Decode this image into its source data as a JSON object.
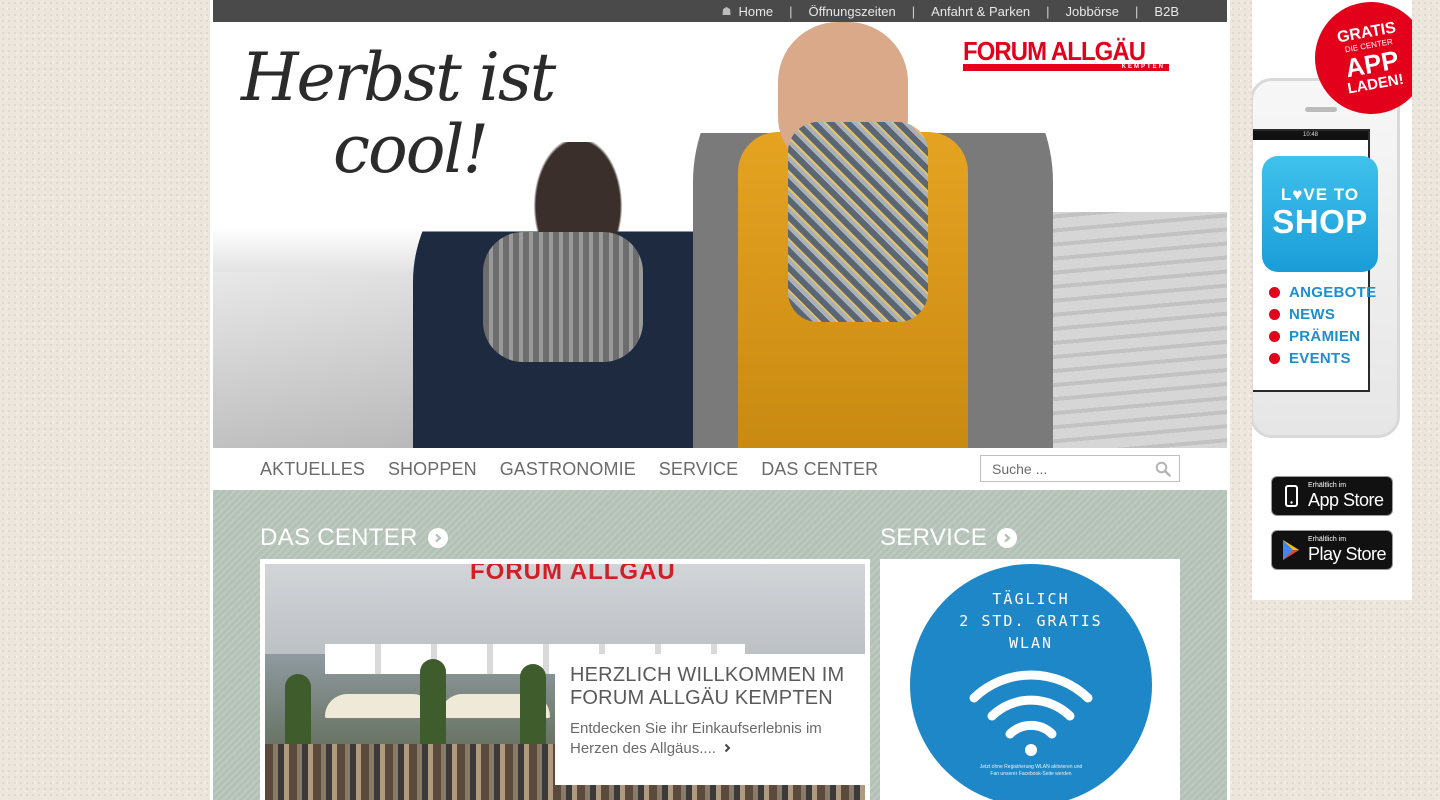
{
  "topnav": {
    "home": "Home",
    "items": [
      "Öffnungszeiten",
      "Anfahrt & Parken",
      "Jobbörse",
      "B2B"
    ],
    "separator": "|"
  },
  "hero": {
    "slogan_line1": "Herbst ist",
    "slogan_line2": "cool!",
    "logo_text": "FORUM ALLGÄU",
    "logo_sub": "KEMPTEN"
  },
  "mainnav": {
    "items": [
      "AKTUELLES",
      "SHOPPEN",
      "GASTRONOMIE",
      "SERVICE",
      "DAS CENTER"
    ],
    "search_placeholder": "Suche ..."
  },
  "center_section": {
    "title": "DAS CENTER",
    "photo_sign": "FORUM ALLGÄU",
    "card_title": "HERZLICH WILLKOMMEN IM FORUM ALLGÄU KEMPTEN",
    "card_text": "Entdecken Sie ihr Einkaufserlebnis im Herzen des Allgäus....",
    "more_icon": "chevron-right-icon"
  },
  "service_section": {
    "title": "SERVICE",
    "wlan_headline": "TÄGLICH\n2 STD. GRATIS\nWLAN",
    "wlan_small": "Jetzt ohne Registrierung WLAN aktivieren und\nFan unserer Facebook-Seite werden"
  },
  "ad": {
    "badge_line1": "GRATIS",
    "badge_line2": "DIE CENTER",
    "badge_line3": "APP",
    "badge_line4": "LADEN!",
    "status_time": "10:48",
    "tile_line1": "L♥VE TO",
    "tile_line2": "SHOP",
    "features": [
      "ANGEBOTE",
      "NEWS",
      "PRÄMIEN",
      "EVENTS"
    ],
    "appstore_small": "Erhältlich im",
    "appstore_big": "App Store",
    "playstore_small": "Erhältlich im",
    "playstore_big": "Play Store"
  },
  "colors": {
    "brand_red": "#e2001a",
    "topbar": "#4a4a4a",
    "content_bg": "#b3c1b6",
    "wlan_blue": "#1e87c8",
    "app_blue": "#1c8fd0"
  }
}
